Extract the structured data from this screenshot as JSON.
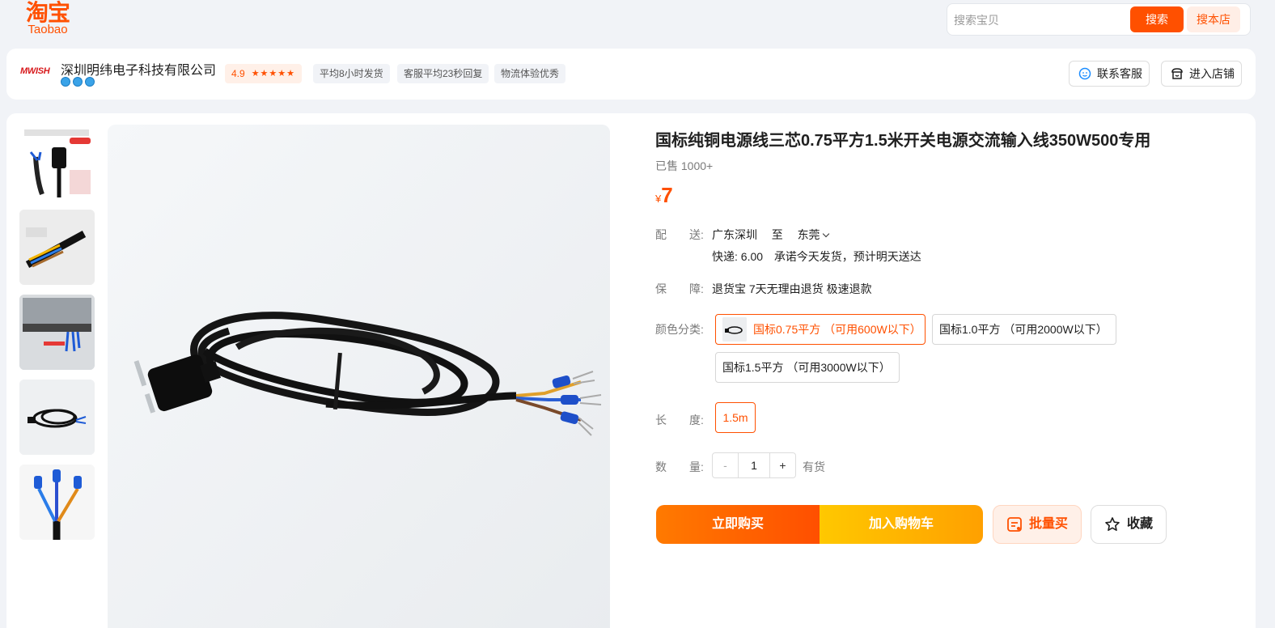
{
  "header": {
    "logo_glyph": "淘宝",
    "logo_word": "Taobao",
    "search_placeholder": "搜索宝贝",
    "search_button": "搜索",
    "shop_search_button": "搜本店"
  },
  "shop": {
    "logo_text": "MWISH",
    "name": "深圳明纬电子科技有限公司",
    "rating": "4.9",
    "rating_stars": 5,
    "tags": [
      "平均8小时发货",
      "客服平均23秒回复",
      "物流体验优秀"
    ],
    "contact_button": "联系客服",
    "enter_shop_button": "进入店铺",
    "colors": {
      "accent": "#ff5000"
    }
  },
  "product": {
    "title": "国标纯铜电源线三芯0.75平方1.5米开关电源交流输入线350W500专用",
    "sold": "已售 1000+",
    "price_symbol": "¥",
    "price": "7",
    "delivery": {
      "label_a": "配",
      "label_b": "送:",
      "from": "广东深圳",
      "to_word": "至",
      "to": "东莞",
      "express": "快递: 6.00",
      "promise": "承诺今天发货，预计明天送达"
    },
    "guarantee": {
      "label_a": "保",
      "label_b": "障:",
      "text": "退货宝 7天无理由退货 极速退款"
    },
    "color": {
      "label": "颜色分类:",
      "options": [
        "国标0.75平方 （可用600W以下）",
        "国标1.0平方 （可用2000W以下）",
        "国标1.5平方 （可用3000W以下）"
      ],
      "selected_index": 0
    },
    "length": {
      "label_a": "长",
      "label_b": "度:",
      "options": [
        "1.5m"
      ]
    },
    "quantity": {
      "label_a": "数",
      "label_b": "量:",
      "minus": "-",
      "value": "1",
      "plus": "+",
      "stock": "有货"
    },
    "actions": {
      "buy_now": "立即购买",
      "add_to_cart": "加入购物车",
      "bulk_buy": "批量买",
      "favorite": "收藏"
    }
  }
}
